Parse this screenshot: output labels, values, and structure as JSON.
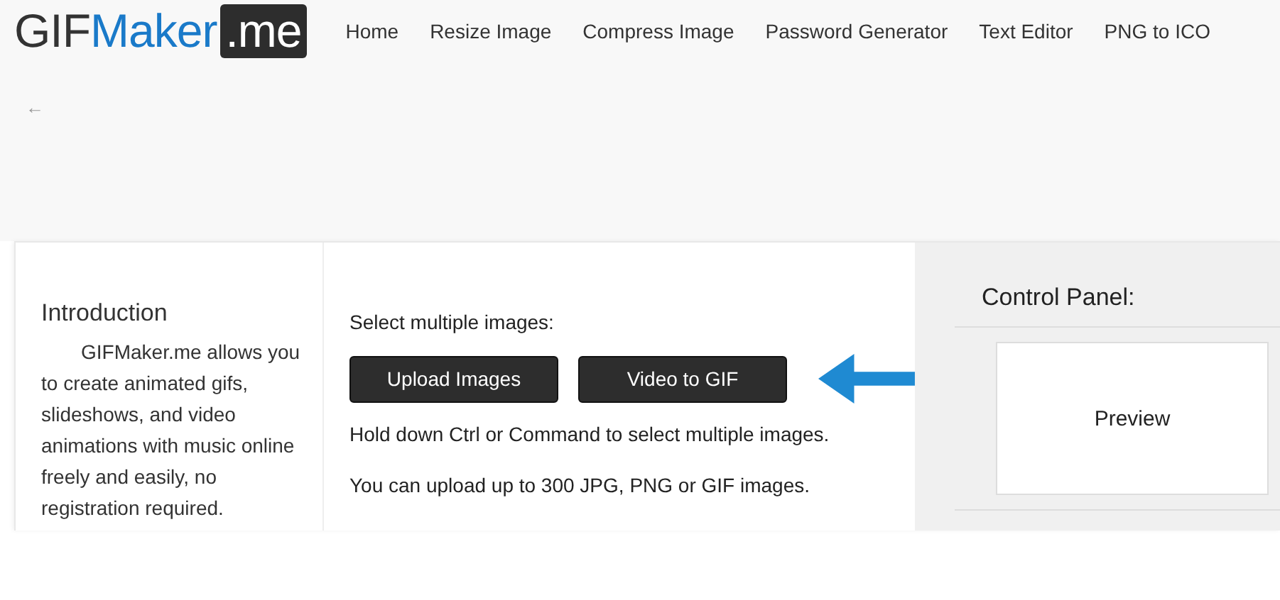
{
  "logo": {
    "prefix": "GIF",
    "highlight": "Maker",
    "badge": ".me"
  },
  "nav": [
    "Home",
    "Resize Image",
    "Compress Image",
    "Password Generator",
    "Text Editor",
    "PNG to ICO"
  ],
  "back": {
    "label": "←"
  },
  "intro": {
    "title": "Introduction",
    "text": "GIFMaker.me allows you to create animated gifs, slideshows, and video animations with music online freely and easily, no registration required."
  },
  "upload": {
    "label": "Select multiple images:",
    "buttons": [
      "Upload Images",
      "Video to GIF"
    ],
    "notes": [
      "Hold down Ctrl or Command to select multiple images.",
      "You can upload up to 300 JPG, PNG or GIF images."
    ]
  },
  "control_panel": {
    "title": "Control Panel:",
    "preview": "Preview"
  }
}
